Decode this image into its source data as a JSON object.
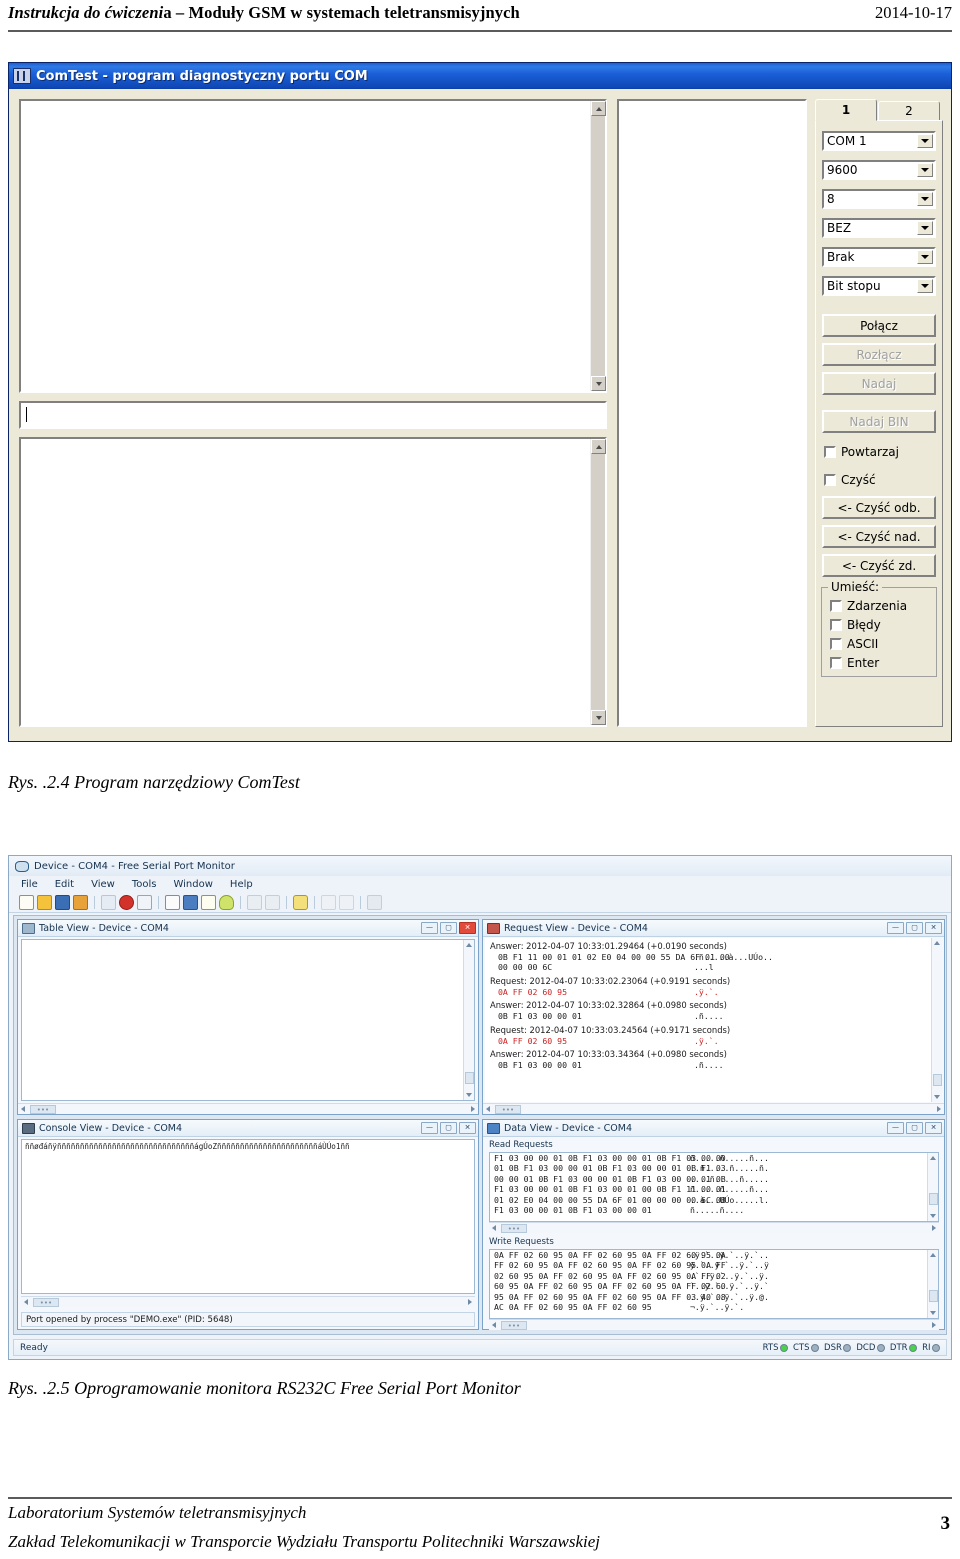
{
  "page": {
    "header_left_italic": "Instrukcja do ćwiczeni",
    "header_left_rest": "a – Moduły GSM w systemach teletransmisyjnych",
    "header_date": "2014-10-17",
    "footer_line1": "Laboratorium Systemów teletransmisyjnych",
    "footer_line2": "Zakład Telekomunikacji w Transporcie Wydziału Transportu Politechniki Warszawskiej",
    "page_number": "3"
  },
  "figure1": {
    "caption": "Rys. .2.4 Program narzędziowy ComTest",
    "window_title": "ComTest - program diagnostyczny portu COM",
    "tabs": [
      {
        "label": "1",
        "selected": true
      },
      {
        "label": "2",
        "selected": false
      }
    ],
    "combos": [
      {
        "name": "port",
        "value": "COM 1"
      },
      {
        "name": "baudrate",
        "value": "9600"
      },
      {
        "name": "databits",
        "value": "8"
      },
      {
        "name": "parity",
        "value": "BEZ"
      },
      {
        "name": "flowcontrol",
        "value": "Brak"
      },
      {
        "name": "stopbits",
        "value": "Bit stopu"
      }
    ],
    "buttons": [
      {
        "name": "connect",
        "label": "Połącz",
        "accel": "P",
        "disabled": false
      },
      {
        "name": "disconnect",
        "label": "Rozłącz",
        "accel": "R",
        "disabled": true
      },
      {
        "name": "send",
        "label": "Nadaj",
        "accel": "N",
        "disabled": true
      },
      {
        "name": "send-bin",
        "label": "Nadaj BIN",
        "accel": "B",
        "disabled": true
      }
    ],
    "checkboxes": [
      {
        "name": "repeat",
        "label": "Powtarzaj",
        "checked": false
      },
      {
        "name": "clear",
        "label": "Czyść",
        "checked": false
      }
    ],
    "clear_buttons": [
      {
        "name": "clear-recv",
        "label": "<- Czyść odb."
      },
      {
        "name": "clear-send",
        "label": "<- Czyść nad."
      },
      {
        "name": "clear-events",
        "label": "<- Czyść zd."
      }
    ],
    "group": {
      "title": "Umieść:",
      "items": [
        {
          "name": "events",
          "label": "Zdarzenia",
          "checked": false
        },
        {
          "name": "errors",
          "label": "Błędy",
          "checked": false
        },
        {
          "name": "ascii",
          "label": "ASCII",
          "checked": false
        },
        {
          "name": "enter",
          "label": "Enter",
          "checked": false
        }
      ]
    },
    "panels": {
      "receive_text": "",
      "input_value": "",
      "send_text": "",
      "events_text": ""
    }
  },
  "figure2": {
    "caption": "Rys. .2.5 Oprogramowanie monitora RS232C Free Serial Port Monitor",
    "window_title": "Device - COM4 - Free Serial Port Monitor",
    "menu": [
      "File",
      "Edit",
      "View",
      "Tools",
      "Window",
      "Help"
    ],
    "toolbar_icons": [
      "new-file-icon",
      "open-folder-icon",
      "save-icon",
      "package-icon",
      "sep",
      "play-icon",
      "stop-icon",
      "pause-icon",
      "sep",
      "copy-icon",
      "window-tile-icon",
      "page-icon",
      "bulb-icon",
      "sep",
      "zoom-in-icon",
      "zoom-out-icon",
      "sep",
      "comment-icon",
      "sep",
      "print-icon",
      "export-icon",
      "sep",
      "help-icon"
    ],
    "children": {
      "table_view": {
        "title": "Table View - Device - COM4",
        "icon": "table-icon",
        "content": ""
      },
      "request_view": {
        "title": "Request View - Device - COM4",
        "icon": "request-icon",
        "lines": [
          {
            "type": "label",
            "text": "Answer: 2012-04-07 10:33:01.29464 (+0.0190 seconds)"
          },
          {
            "type": "hex",
            "hex": "0B F1 11 00 01 01 02 E0 04 00 00 55 DA 6F 01 00",
            "ascii": ".ñ.....à...UÚo..",
            "color": "black"
          },
          {
            "type": "hex",
            "hex": "00 00 00 6C",
            "ascii": "...l",
            "color": "black"
          },
          {
            "type": "label",
            "text": "Request: 2012-04-07 10:33:02.23064 (+0.9191 seconds)"
          },
          {
            "type": "hex",
            "hex": "0A FF 02 60 95",
            "ascii": ".ÿ.`.",
            "color": "red"
          },
          {
            "type": "label",
            "text": "Answer: 2012-04-07 10:33:02.32864 (+0.0980 seconds)"
          },
          {
            "type": "hex",
            "hex": "0B F1 03 00 00 01",
            "ascii": ".ñ....",
            "color": "black"
          },
          {
            "type": "label",
            "text": "Request: 2012-04-07 10:33:03.24564 (+0.9171 seconds)"
          },
          {
            "type": "hex",
            "hex": "0A FF 02 60 95",
            "ascii": ".ÿ.`.",
            "color": "red"
          },
          {
            "type": "label",
            "text": "Answer: 2012-04-07 10:33:03.34364 (+0.0980 seconds)"
          },
          {
            "type": "hex",
            "hex": "0B F1 03 00 00 01",
            "ascii": ".ñ....",
            "color": "black"
          }
        ]
      },
      "console_view": {
        "title": "Console View - Device - COM4",
        "icon": "console-icon",
        "content": "ññøđáñÿññññññññññññññññññññññññññññññágÚoZññññññññññññññññññññññáÙÚo1ññ",
        "status": "Port opened by process \"DEMO.exe\" (PID: 5648)"
      },
      "data_view": {
        "title": "Data View - Device - COM4",
        "icon": "data-icon",
        "read_label": "Read Requests",
        "read_rows": [
          {
            "hex": "F1 03 00 00 01 0B F1 03 00 00 01 0B F1 03 00 00",
            "ascii": "ñ.....ñ.....ñ..."
          },
          {
            "hex": "01 0B F1 03 00 00 01 0B F1 03 00 00 01 0B F1 03",
            "ascii": "..ñ.....ñ.....ñ."
          },
          {
            "hex": "00 00 01 0B F1 03 00 00 01 0B F1 03 00 00 01 0B",
            "ascii": "....ñ.....ñ....."
          },
          {
            "hex": "F1 03 00 00 01 0B F1 03 00 01 00 0B F1 11 00 01",
            "ascii": "ñ.....ñ.....ñ..."
          },
          {
            "hex": "01 02 E0 04 00 00 55 DA 6F 01 00 00 00 00 6C 0B",
            "ascii": "..à...UÚo.....l."
          },
          {
            "hex": "F1 03 00 00 01 0B F1 03 00 00 01",
            "ascii": "ñ.....ñ...."
          }
        ],
        "write_label": "Write Requests",
        "write_rows": [
          {
            "hex": "0A FF 02 60 95 0A FF 02 60 95 0A FF 02 60 95 0A",
            "ascii": ".ÿ.`..ÿ.`..ÿ.`.."
          },
          {
            "hex": "FF 02 60 95 0A FF 02 60 95 0A FF 02 60 95 0A FF",
            "ascii": "ÿ.`..ÿ.`..ÿ.`..ÿ"
          },
          {
            "hex": "02 60 95 0A FF 02 60 95 0A FF 02 60 95 0A FF 02",
            "ascii": ".`..ÿ.`..ÿ.`..ÿ."
          },
          {
            "hex": "60 95 0A FF 02 60 95 0A FF 02 60 95 0A FF 02 60",
            "ascii": "`..ÿ.`..ÿ.`..ÿ.`"
          },
          {
            "hex": "95 0A FF 02 60 95 0A FF 02 60 95 0A FF 03 40 08",
            "ascii": "..ÿ.`..ÿ.`..ÿ.@."
          },
          {
            "hex": "AC 0A FF 02 60 95 0A FF 02 60 95",
            "ascii": "¬.ÿ.`..ÿ.`."
          }
        ]
      }
    },
    "status_bar": {
      "text": "Ready",
      "signals": [
        {
          "label": "RTS",
          "on": true
        },
        {
          "label": "CTS",
          "on": false
        },
        {
          "label": "DSR",
          "on": false
        },
        {
          "label": "DCD",
          "on": false
        },
        {
          "label": "DTR",
          "on": true
        },
        {
          "label": "RI",
          "on": false
        }
      ]
    }
  }
}
